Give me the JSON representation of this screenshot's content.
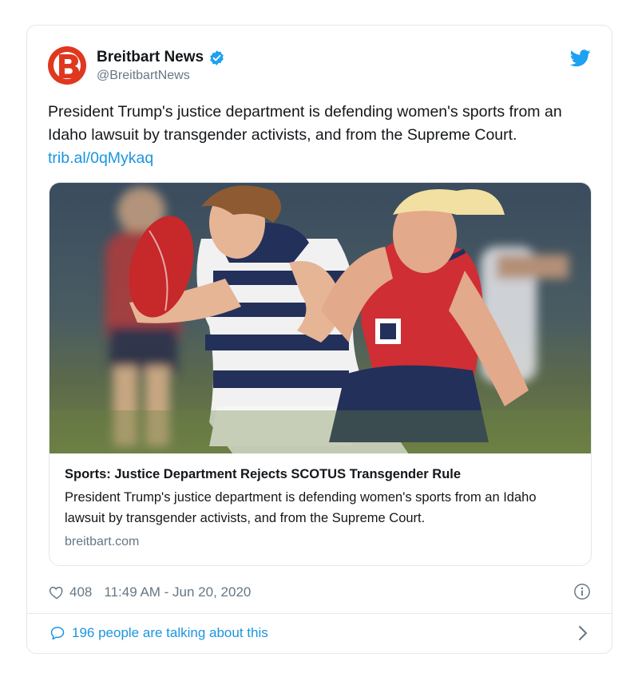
{
  "tweet": {
    "author": {
      "name": "Breitbart News",
      "handle": "@BreitbartNews",
      "avatar_letter": "B",
      "avatar_color": "#e0371f",
      "verified": true
    },
    "text": "President Trump's justice department is defending women's sports from an Idaho lawsuit by transgender activists, and from the Supreme Court.",
    "link": "trib.al/0qMykaq",
    "card": {
      "image_alt": "Football player in navy and white striped jersey holding a red ball, tackled by a player in red and navy jersey",
      "title": "Sports: Justice Department Rejects SCOTUS Transgender Rule",
      "description": "President Trump's justice department is defending women's sports from an Idaho lawsuit by transgender activists, and from the Supreme Court.",
      "domain": "breitbart.com"
    },
    "likes": "408",
    "timestamp": "11:49 AM - Jun 20, 2020",
    "talking": "196 people are talking about this"
  },
  "colors": {
    "link": "#1b95e0",
    "muted": "#657786",
    "border": "#e1e8ed",
    "brand": "#e0371f"
  },
  "icons": [
    "verified-badge-icon",
    "twitter-bird-icon",
    "heart-icon",
    "info-icon",
    "comment-bubble-icon",
    "chevron-right-icon"
  ]
}
